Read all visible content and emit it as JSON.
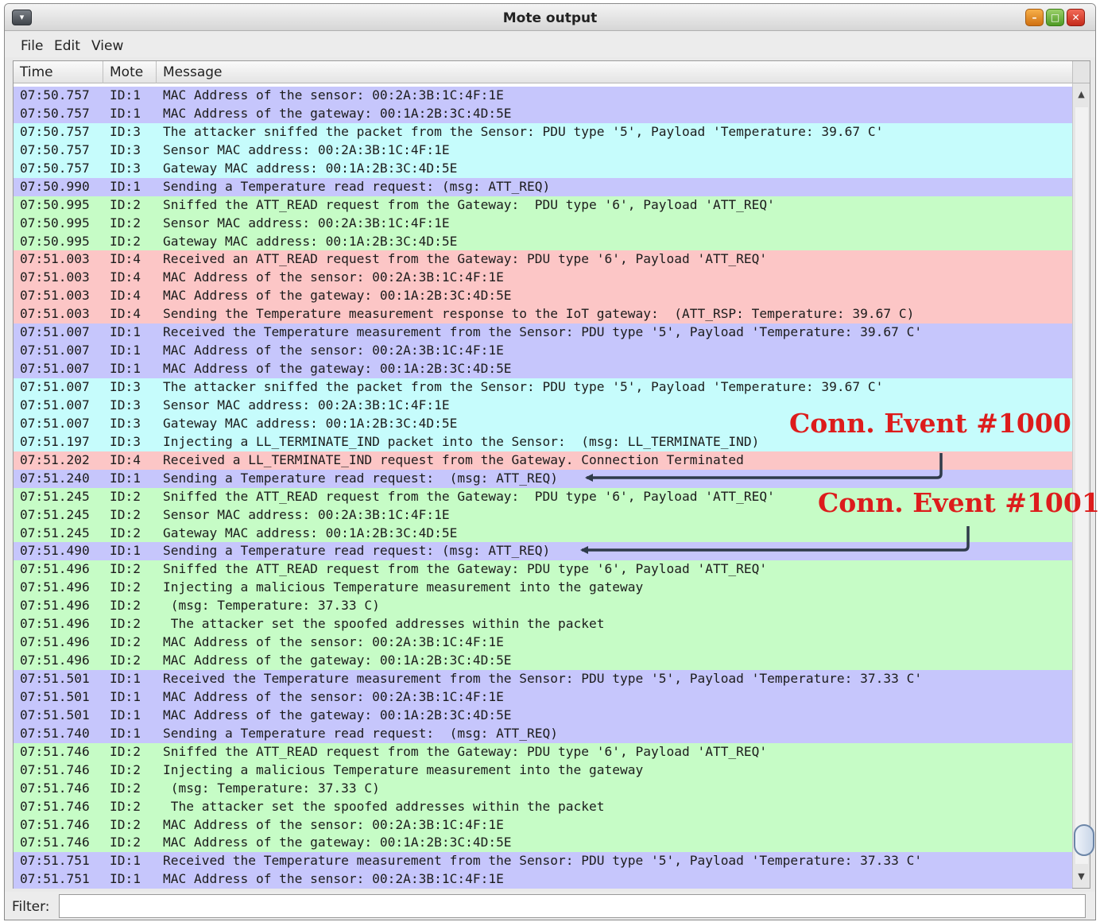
{
  "window": {
    "title": "Mote output",
    "menu_glyph": "▾",
    "buttons": {
      "minimize": "–",
      "maximize": "□",
      "close": "✕"
    }
  },
  "menu": [
    {
      "label": "File"
    },
    {
      "label": "Edit"
    },
    {
      "label": "View"
    }
  ],
  "table": {
    "columns": {
      "time": "Time",
      "mote": "Mote",
      "message": "Message"
    },
    "colors": {
      "ID:1": "#c6c6fc",
      "ID:2": "#c6fcc6",
      "ID:3": "#c6fcfc",
      "ID:4": "#fcc6c6"
    },
    "rows": [
      {
        "time": "07:50.757",
        "mote": "ID:1",
        "message": "MAC Address of the sensor: 00:2A:3B:1C:4F:1E"
      },
      {
        "time": "07:50.757",
        "mote": "ID:1",
        "message": "MAC Address of the gateway: 00:1A:2B:3C:4D:5E"
      },
      {
        "time": "07:50.757",
        "mote": "ID:3",
        "message": "The attacker sniffed the packet from the Sensor: PDU type '5', Payload 'Temperature: 39.67 C'"
      },
      {
        "time": "07:50.757",
        "mote": "ID:3",
        "message": "Sensor MAC address: 00:2A:3B:1C:4F:1E"
      },
      {
        "time": "07:50.757",
        "mote": "ID:3",
        "message": "Gateway MAC address: 00:1A:2B:3C:4D:5E"
      },
      {
        "time": "07:50.990",
        "mote": "ID:1",
        "message": "Sending a Temperature read request: (msg: ATT_REQ)"
      },
      {
        "time": "07:50.995",
        "mote": "ID:2",
        "message": "Sniffed the ATT_READ request from the Gateway:  PDU type '6', Payload 'ATT_REQ'"
      },
      {
        "time": "07:50.995",
        "mote": "ID:2",
        "message": "Sensor MAC address: 00:2A:3B:1C:4F:1E"
      },
      {
        "time": "07:50.995",
        "mote": "ID:2",
        "message": "Gateway MAC address: 00:1A:2B:3C:4D:5E"
      },
      {
        "time": "07:51.003",
        "mote": "ID:4",
        "message": "Received an ATT_READ request from the Gateway: PDU type '6', Payload 'ATT_REQ'"
      },
      {
        "time": "07:51.003",
        "mote": "ID:4",
        "message": "MAC Address of the sensor: 00:2A:3B:1C:4F:1E"
      },
      {
        "time": "07:51.003",
        "mote": "ID:4",
        "message": "MAC Address of the gateway: 00:1A:2B:3C:4D:5E"
      },
      {
        "time": "07:51.003",
        "mote": "ID:4",
        "message": "Sending the Temperature measurement response to the IoT gateway:  (ATT_RSP: Temperature: 39.67 C)"
      },
      {
        "time": "07:51.007",
        "mote": "ID:1",
        "message": "Received the Temperature measurement from the Sensor: PDU type '5', Payload 'Temperature: 39.67 C'"
      },
      {
        "time": "07:51.007",
        "mote": "ID:1",
        "message": "MAC Address of the sensor: 00:2A:3B:1C:4F:1E"
      },
      {
        "time": "07:51.007",
        "mote": "ID:1",
        "message": "MAC Address of the gateway: 00:1A:2B:3C:4D:5E"
      },
      {
        "time": "07:51.007",
        "mote": "ID:3",
        "message": "The attacker sniffed the packet from the Sensor: PDU type '5', Payload 'Temperature: 39.67 C'"
      },
      {
        "time": "07:51.007",
        "mote": "ID:3",
        "message": "Sensor MAC address: 00:2A:3B:1C:4F:1E"
      },
      {
        "time": "07:51.007",
        "mote": "ID:3",
        "message": "Gateway MAC address: 00:1A:2B:3C:4D:5E"
      },
      {
        "time": "07:51.197",
        "mote": "ID:3",
        "message": "Injecting a LL_TERMINATE_IND packet into the Sensor:  (msg: LL_TERMINATE_IND)"
      },
      {
        "time": "07:51.202",
        "mote": "ID:4",
        "message": "Received a LL_TERMINATE_IND request from the Gateway. Connection Terminated"
      },
      {
        "time": "07:51.240",
        "mote": "ID:1",
        "message": "Sending a Temperature read request:  (msg: ATT_REQ)"
      },
      {
        "time": "07:51.245",
        "mote": "ID:2",
        "message": "Sniffed the ATT_READ request from the Gateway:  PDU type '6', Payload 'ATT_REQ'"
      },
      {
        "time": "07:51.245",
        "mote": "ID:2",
        "message": "Sensor MAC address: 00:2A:3B:1C:4F:1E"
      },
      {
        "time": "07:51.245",
        "mote": "ID:2",
        "message": "Gateway MAC address: 00:1A:2B:3C:4D:5E"
      },
      {
        "time": "07:51.490",
        "mote": "ID:1",
        "message": "Sending a Temperature read request: (msg: ATT_REQ)"
      },
      {
        "time": "07:51.496",
        "mote": "ID:2",
        "message": "Sniffed the ATT_READ request from the Gateway: PDU type '6', Payload 'ATT_REQ'"
      },
      {
        "time": "07:51.496",
        "mote": "ID:2",
        "message": "Injecting a malicious Temperature measurement into the gateway"
      },
      {
        "time": "07:51.496",
        "mote": "ID:2",
        "message": " (msg: Temperature: 37.33 C)"
      },
      {
        "time": "07:51.496",
        "mote": "ID:2",
        "message": " The attacker set the spoofed addresses within the packet"
      },
      {
        "time": "07:51.496",
        "mote": "ID:2",
        "message": "MAC Address of the sensor: 00:2A:3B:1C:4F:1E"
      },
      {
        "time": "07:51.496",
        "mote": "ID:2",
        "message": "MAC Address of the gateway: 00:1A:2B:3C:4D:5E"
      },
      {
        "time": "07:51.501",
        "mote": "ID:1",
        "message": "Received the Temperature measurement from the Sensor: PDU type '5', Payload 'Temperature: 37.33 C'"
      },
      {
        "time": "07:51.501",
        "mote": "ID:1",
        "message": "MAC Address of the sensor: 00:2A:3B:1C:4F:1E"
      },
      {
        "time": "07:51.501",
        "mote": "ID:1",
        "message": "MAC Address of the gateway: 00:1A:2B:3C:4D:5E"
      },
      {
        "time": "07:51.740",
        "mote": "ID:1",
        "message": "Sending a Temperature read request:  (msg: ATT_REQ)"
      },
      {
        "time": "07:51.746",
        "mote": "ID:2",
        "message": "Sniffed the ATT_READ request from the Gateway: PDU type '6', Payload 'ATT_REQ'"
      },
      {
        "time": "07:51.746",
        "mote": "ID:2",
        "message": "Injecting a malicious Temperature measurement into the gateway"
      },
      {
        "time": "07:51.746",
        "mote": "ID:2",
        "message": " (msg: Temperature: 37.33 C)"
      },
      {
        "time": "07:51.746",
        "mote": "ID:2",
        "message": " The attacker set the spoofed addresses within the packet"
      },
      {
        "time": "07:51.746",
        "mote": "ID:2",
        "message": "MAC Address of the sensor: 00:2A:3B:1C:4F:1E"
      },
      {
        "time": "07:51.746",
        "mote": "ID:2",
        "message": "MAC Address of the gateway: 00:1A:2B:3C:4D:5E"
      },
      {
        "time": "07:51.751",
        "mote": "ID:1",
        "message": "Received the Temperature measurement from the Sensor: PDU type '5', Payload 'Temperature: 37.33 C'"
      },
      {
        "time": "07:51.751",
        "mote": "ID:1",
        "message": "MAC Address of the sensor: 00:2A:3B:1C:4F:1E"
      }
    ]
  },
  "scrollbar": {
    "up_glyph": "▲",
    "down_glyph": "▼"
  },
  "filter": {
    "label": "Filter:",
    "value": "",
    "placeholder": ""
  },
  "annotations": [
    {
      "text": "Conn. Event #1000",
      "color": "#dd1c1c"
    },
    {
      "text": "Conn. Event #1001",
      "color": "#dd1c1c"
    }
  ]
}
